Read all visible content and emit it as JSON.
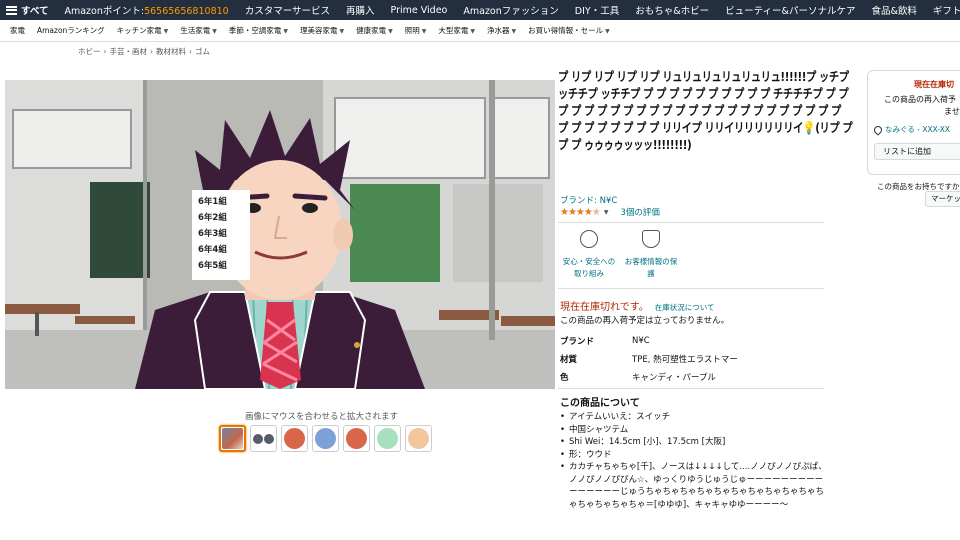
{
  "nav": {
    "all_label": "すべて",
    "points_label": "Amazonポイント:",
    "points_value": "56565656810810",
    "items": [
      "カスタマーサービス",
      "再購入",
      "Prime Video",
      "Amazonファッション",
      "DIY・工具",
      "おもちゃ&ホビー",
      "ビューティー&パーソナルケア",
      "食品&飲料",
      "ギフトランキング"
    ]
  },
  "subnav": {
    "items": [
      "家電",
      "Amazonランキング",
      "キッチン家電",
      "生活家電",
      "季節・空調家電",
      "理美容家電",
      "健康家電",
      "照明",
      "大型家電",
      "浄水器",
      "お買い得情報・セール"
    ]
  },
  "breadcrumb": [
    "ホビー",
    "手芸・画材",
    "教材材料",
    "ゴム"
  ],
  "image": {
    "plaque_lines": [
      "6年1組",
      "6年2組",
      "6年3組",
      "6年4組",
      "6年5組"
    ],
    "zoom_hint": "画像にマウスを合わせると拡大されます"
  },
  "thumbnails": [
    {
      "kind": "photo",
      "color": "#7a8db0"
    },
    {
      "kind": "pair",
      "color": "#565d66"
    },
    {
      "kind": "circle",
      "color": "#d9654a"
    },
    {
      "kind": "circle",
      "color": "#7ba1d6"
    },
    {
      "kind": "circle",
      "color": "#d9654a"
    },
    {
      "kind": "circle",
      "color": "#a8e0be"
    },
    {
      "kind": "circle",
      "color": "#f3c79e"
    }
  ],
  "product": {
    "title": "プ リプ リプ リプ リプ リュリュリュリュリュリュ!!!!!!プ ッチプ ッチチプ ッチチプ プ プ プ プ プ プ プ プ プ プ チチチチプ プ プ プ プ プ プ プ プ プ プ プ プ プ プ プ プ プ プ プ プ プ プ プ プ プ プ プ プ プ プ プ プ リリイプ リリイリリリリリリイ💡(リプ プ プ プ ゥゥゥゥッッッ!!!!!!!!)",
    "brand_link": "ブランド: N¥C",
    "stars": "★★★★",
    "stars_half": "★",
    "rating_count": "3個の評価",
    "badges": [
      "安心・安全への取り組み",
      "お客様情報の保護"
    ],
    "stock_status": "現在在庫切れです。",
    "stock_link": "在庫状況について",
    "restock_note": "この商品の再入荷予定は立っておりません。",
    "specs": [
      {
        "key": "ブランド",
        "value": "N¥C"
      },
      {
        "key": "材質",
        "value": "TPE, 熱可塑性エラストマー"
      },
      {
        "key": "色",
        "value": "キャンディ・パープル"
      }
    ],
    "about_title": "この商品について",
    "bullets": [
      "アイテムいいえ：スイッチ",
      "中国シャツテム",
      "Shi Wei：14.5cm [小]、17.5cm [大阪]",
      "形：ウウド",
      "カカチャちゃちゃ[千]、ノースは↓↓↓↓して....ノノぴノノぴぷぱ、ノノぴノノぴぴん☆、ゆっくりゆうじゅうじゅーーーーーーーーーーーーーーーじゅうちゃちゃちゃちゃちゃちゃちゃちゃちゃちゃちゃちゃちゃちゃちゃ＝[ゆゆゆ]、キャキャゆゆーーーー〜"
    ]
  },
  "buybox": {
    "stock": "現在在庫切",
    "restock_line1": "この商品の再入荷予",
    "restock_line2": "ませ",
    "deliver": "なみぐる - XXX-XX",
    "list_button": "リストに追加",
    "sell_label": "この商品をお持ちですか",
    "sell_button": "マーケッ"
  }
}
